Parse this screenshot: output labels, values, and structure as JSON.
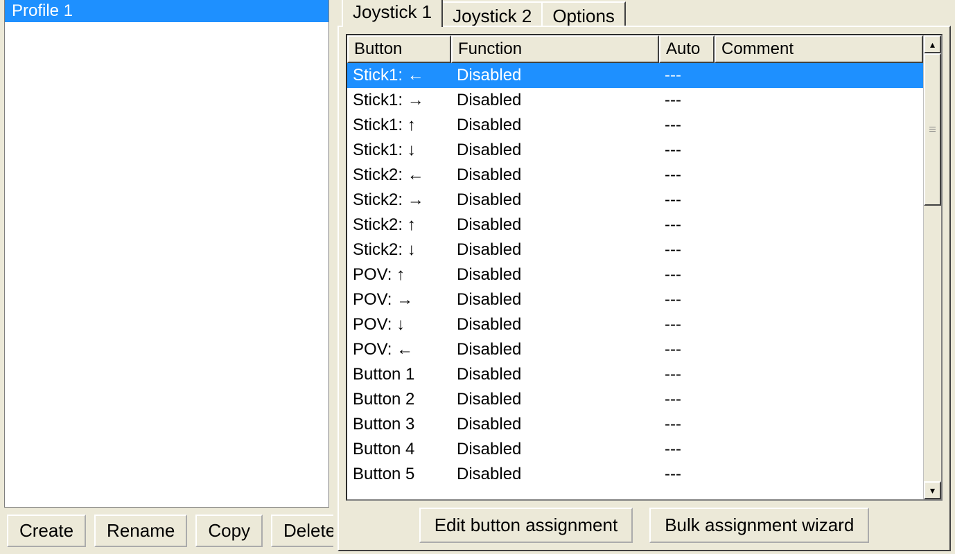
{
  "colors": {
    "selection": "#1e90ff"
  },
  "left": {
    "profiles": [
      {
        "label": "Profile 1",
        "selected": true
      }
    ],
    "buttons": {
      "create": "Create",
      "rename": "Rename",
      "copy": "Copy",
      "delete": "Delete"
    }
  },
  "right": {
    "tabs": [
      {
        "label": "Joystick 1",
        "active": true
      },
      {
        "label": "Joystick 2",
        "active": false
      },
      {
        "label": "Options",
        "active": false
      }
    ],
    "columns": {
      "button": "Button",
      "function": "Function",
      "auto": "Auto",
      "comment": "Comment"
    },
    "rows": [
      {
        "button": "Stick1: ←",
        "function": "Disabled",
        "auto": "---",
        "comment": "",
        "selected": true
      },
      {
        "button": "Stick1: →",
        "function": "Disabled",
        "auto": "---",
        "comment": ""
      },
      {
        "button": "Stick1: ↑",
        "function": "Disabled",
        "auto": "---",
        "comment": ""
      },
      {
        "button": "Stick1: ↓",
        "function": "Disabled",
        "auto": "---",
        "comment": ""
      },
      {
        "button": "Stick2: ←",
        "function": "Disabled",
        "auto": "---",
        "comment": ""
      },
      {
        "button": "Stick2: →",
        "function": "Disabled",
        "auto": "---",
        "comment": ""
      },
      {
        "button": "Stick2: ↑",
        "function": "Disabled",
        "auto": "---",
        "comment": ""
      },
      {
        "button": "Stick2: ↓",
        "function": "Disabled",
        "auto": "---",
        "comment": ""
      },
      {
        "button": "POV: ↑",
        "function": "Disabled",
        "auto": "---",
        "comment": ""
      },
      {
        "button": "POV: →",
        "function": "Disabled",
        "auto": "---",
        "comment": ""
      },
      {
        "button": "POV: ↓",
        "function": "Disabled",
        "auto": "---",
        "comment": ""
      },
      {
        "button": "POV: ←",
        "function": "Disabled",
        "auto": "---",
        "comment": ""
      },
      {
        "button": "Button 1",
        "function": "Disabled",
        "auto": "---",
        "comment": ""
      },
      {
        "button": "Button 2",
        "function": "Disabled",
        "auto": "---",
        "comment": ""
      },
      {
        "button": "Button 3",
        "function": "Disabled",
        "auto": "---",
        "comment": ""
      },
      {
        "button": "Button 4",
        "function": "Disabled",
        "auto": "---",
        "comment": ""
      },
      {
        "button": "Button 5",
        "function": "Disabled",
        "auto": "---",
        "comment": ""
      }
    ],
    "buttons": {
      "edit": "Edit button assignment",
      "bulk": "Bulk assignment wizard"
    }
  }
}
